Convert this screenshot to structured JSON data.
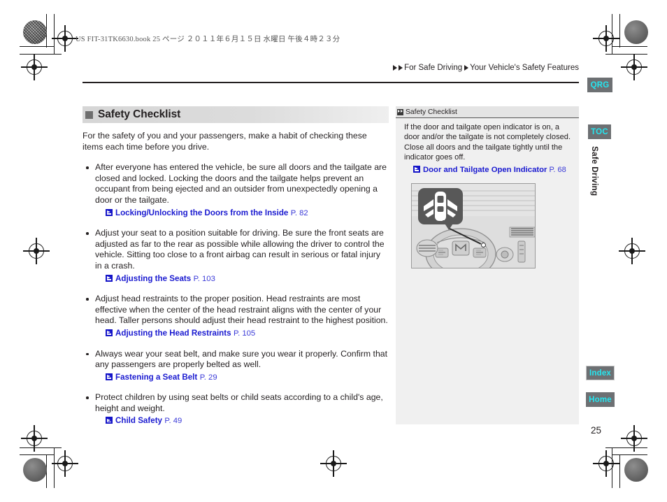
{
  "page": {
    "file_info": "US FIT-31TK6630.book   25 ページ   ２０１１年６月１５日   水曜日   午後４時２３分",
    "page_number": "25",
    "breadcrumb": {
      "level1": "For Safe Driving",
      "level2": "Your Vehicle's Safety Features"
    },
    "colors": {
      "link": "#1a1ad0",
      "tab_bg": "#6d7073",
      "tab_text": "#25e6f0",
      "section_header_bg": "#d6d6d6",
      "sidebar_bg": "#f0f0f0"
    }
  },
  "main": {
    "section_title": "Safety Checklist",
    "intro": "For the safety of you and your passengers, make a habit of checking these items each time before you drive.",
    "bullets": [
      {
        "text": "After everyone has entered the vehicle, be sure all doors and the tailgate are closed and locked. Locking the doors and the tailgate helps prevent an occupant from being ejected and an outsider from unexpectedly opening a door or the tailgate.",
        "xref_title": "Locking/Unlocking the Doors from the Inside",
        "xref_page": "P. 82"
      },
      {
        "text": "Adjust your seat to a position suitable for driving. Be sure the front seats are adjusted as far to the rear as possible while allowing the driver to control the vehicle. Sitting too close to a front airbag can result in serious or fatal injury in a crash.",
        "xref_title": "Adjusting the Seats",
        "xref_page": "P. 103"
      },
      {
        "text": "Adjust head restraints to the proper position. Head restraints are most effective when the center of the head restraint aligns with the center of your head. Taller persons should adjust their head restraint to the highest position.",
        "xref_title": "Adjusting the Head Restraints",
        "xref_page": "P. 105"
      },
      {
        "text": "Always wear your seat belt, and make sure you wear it properly. Confirm that any passengers are properly belted as well.",
        "xref_title": "Fastening a Seat Belt",
        "xref_page": "P. 29"
      },
      {
        "text": "Protect children by using seat belts or child seats according to a child's age, height and weight.",
        "xref_title": "Child Safety",
        "xref_page": "P. 49"
      }
    ]
  },
  "sidebar": {
    "header": "Safety Checklist",
    "body": "If the door and tailgate open indicator is on, a door and/or the tailgate is not completely closed. Close all doors and the tailgate tightly until the indicator goes off.",
    "xref_title": "Door and Tailgate Open Indicator",
    "xref_page": "P. 68",
    "illustration_caption": "Dashboard with door and tailgate open indicator callout"
  },
  "tabs": {
    "qrg": "QRG",
    "toc": "TOC",
    "chapter": "Safe Driving",
    "index": "Index",
    "home": "Home"
  }
}
